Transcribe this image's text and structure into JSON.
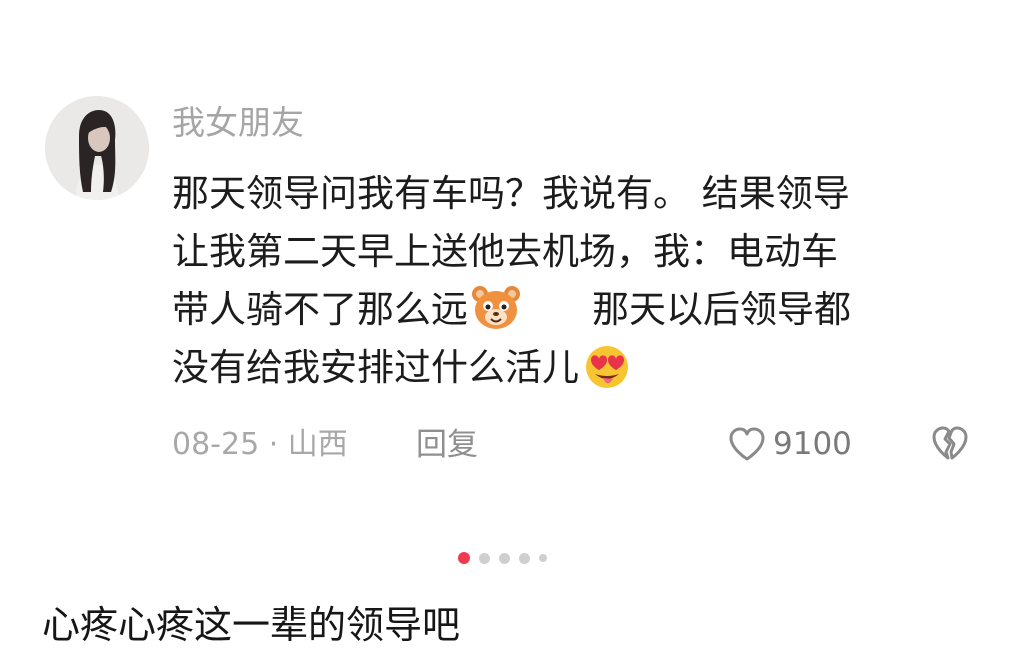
{
  "comment": {
    "username": "我女朋友",
    "lines": [
      "那天领导问我有车吗？我说有。 结果领导",
      "让我第二天早上送他去机场，我：电动车",
      "带人骑不了那么远",
      "那天以后领导都",
      "没有给我安排过什么活儿"
    ],
    "emojis": [
      "bear-emoji",
      "heart-eyes-tongue-emoji"
    ],
    "date_location": "08-25 · 山西",
    "reply_label": "回复",
    "like_count": "9100",
    "icons": [
      "heart-outline-icon",
      "broken-heart-icon"
    ]
  },
  "pager": {
    "total": 5,
    "active_index": 0,
    "active_color": "#ef3b4f",
    "inactive_color": "#cfcfcf"
  },
  "caption": "心疼心疼这一辈的领导吧"
}
